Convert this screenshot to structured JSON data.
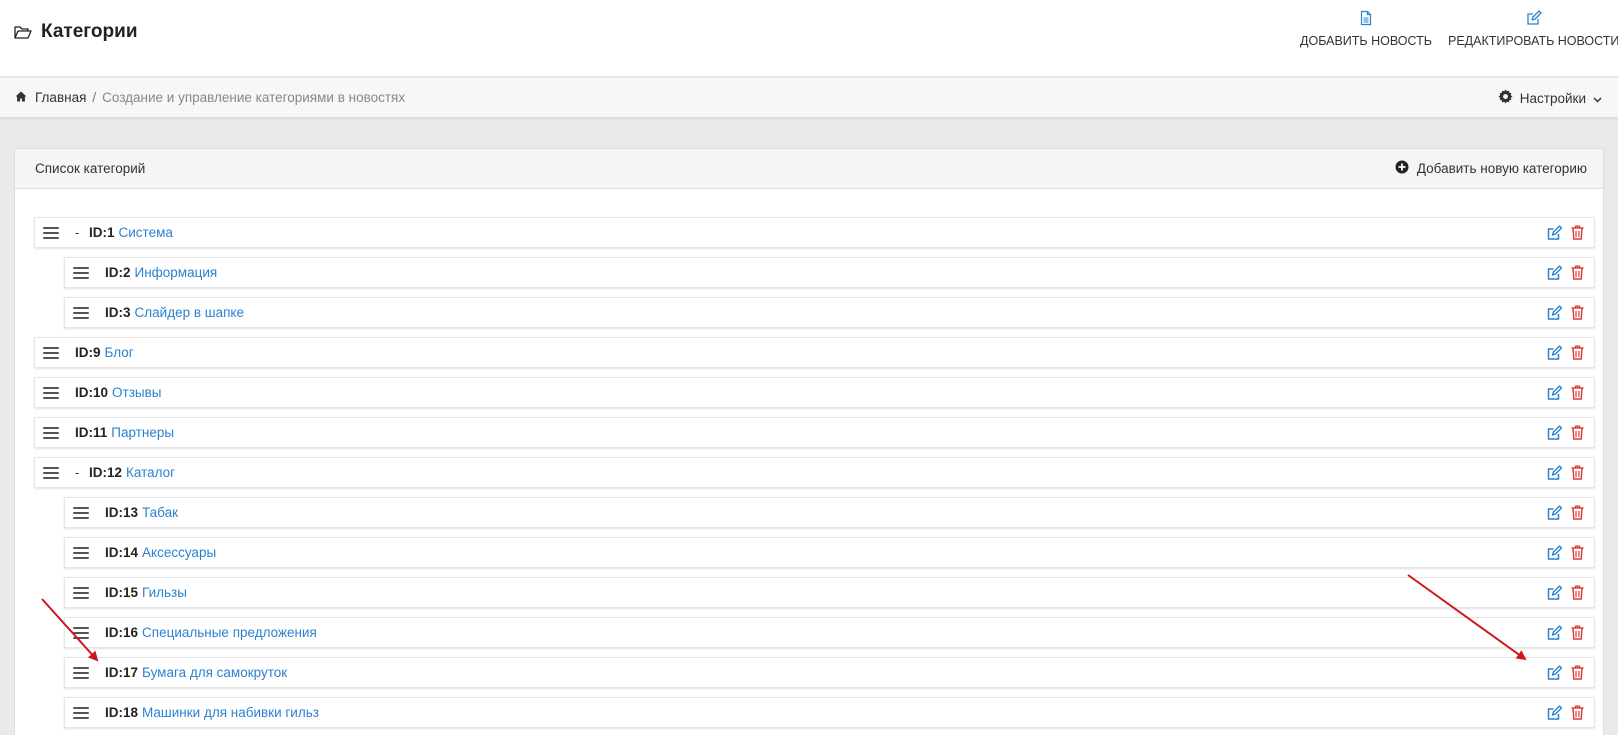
{
  "header": {
    "title": "Категории",
    "add_news_label": "ДОБАВИТЬ НОВОСТЬ",
    "edit_news_label": "РЕДАКТИРОВАТЬ НОВОСТИ"
  },
  "breadcrumb": {
    "home": "Главная",
    "separator": "/",
    "current": "Создание и управление категориями в новостях"
  },
  "settings_label": "Настройки",
  "panel": {
    "title": "Список категорий",
    "add_label": "Добавить новую категорию"
  },
  "categories": [
    {
      "id": "ID:1",
      "name": "Система",
      "toggle": "-"
    },
    {
      "id": "ID:2",
      "name": "Информация"
    },
    {
      "id": "ID:3",
      "name": "Слайдер в шапке"
    },
    {
      "id": "ID:9",
      "name": "Блог"
    },
    {
      "id": "ID:10",
      "name": "Отзывы"
    },
    {
      "id": "ID:11",
      "name": "Партнеры"
    },
    {
      "id": "ID:12",
      "name": "Каталог",
      "toggle": "-"
    },
    {
      "id": "ID:13",
      "name": "Табак"
    },
    {
      "id": "ID:14",
      "name": "Аксессуары"
    },
    {
      "id": "ID:15",
      "name": "Гильзы"
    },
    {
      "id": "ID:16",
      "name": "Специальные предложения"
    },
    {
      "id": "ID:17",
      "name": "Бумага для самокруток"
    },
    {
      "id": "ID:18",
      "name": "Машинки для набивки гильз"
    }
  ],
  "colors": {
    "link": "#2a82d0",
    "edit_icon": "#2a82d0",
    "delete_icon": "#e03535",
    "annotation_arrow": "#d0161d"
  },
  "icons": {
    "title": "folder-open-icon",
    "add_news": "file-icon",
    "edit_news": "edit-icon",
    "home": "home-icon",
    "settings": "gear-icon",
    "add_category": "plus-circle-icon",
    "row_drag": "drag-handle-icon",
    "row_edit": "edit-icon",
    "row_delete": "trash-icon"
  }
}
